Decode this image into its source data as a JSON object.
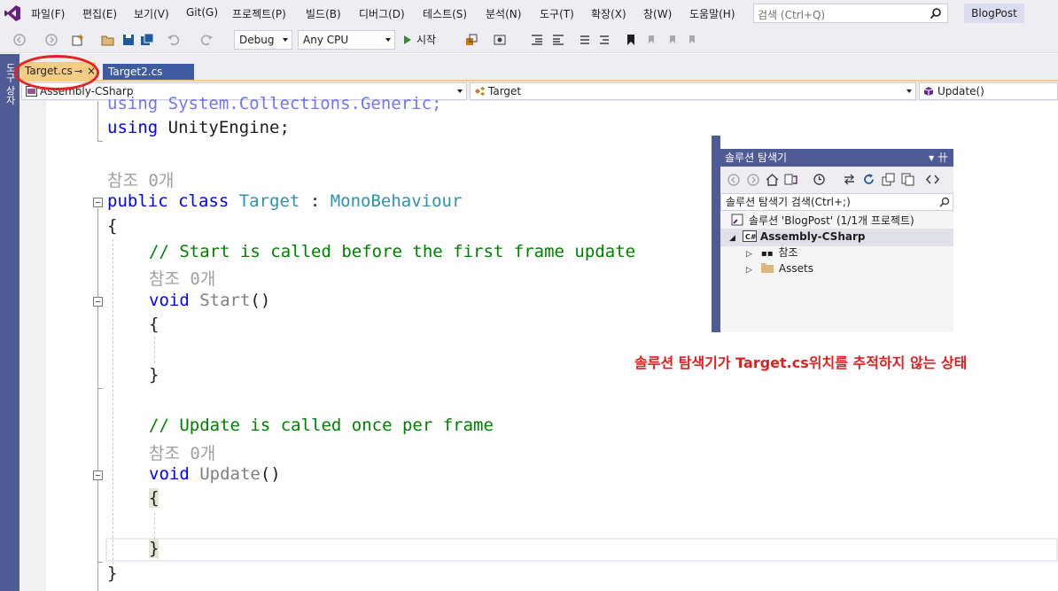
{
  "menu": {
    "items": [
      "파일(F)",
      "편집(E)",
      "보기(V)",
      "Git(G)",
      "프로젝트(P)",
      "빌드(B)",
      "디버그(D)",
      "테스트(S)",
      "분석(N)",
      "도구(T)",
      "확장(X)",
      "창(W)",
      "도움말(H)"
    ],
    "search_placeholder": "검색 (Ctrl+Q)",
    "project_name": "BlogPost"
  },
  "toolbar": {
    "config": "Debug",
    "platform": "Any CPU",
    "start_label": "시작"
  },
  "left_strip_label": "도구 상자",
  "tabs": {
    "active": "Target.cs",
    "active_pin": "⊸",
    "active_close": "×",
    "inactive": "Target2.cs"
  },
  "navbar": {
    "project": "Assembly-CSharp",
    "type": "Target",
    "member": "Update()"
  },
  "code": {
    "l1": "using System.Collections.Generic;",
    "l2_kw": "using",
    "l2_rest": " UnityEngine;",
    "ref_class": "참조 0개",
    "l4_kw": "public class",
    "l4_type": "Target",
    "l4_colon": " : ",
    "l4_base": "MonoBehaviour",
    "brace_open": "{",
    "brace_close": "}",
    "c_start": "// Start is called before the first frame update",
    "ref_start": "참조 0개",
    "void": "void",
    "start_name": "Start",
    "parens": "()",
    "c_update": "// Update is called once per frame",
    "ref_update": "참조 0개",
    "update_name": "Update"
  },
  "solution_explorer": {
    "title": "솔루션 탐색기",
    "header_pin": "▾ 卄",
    "search_placeholder": "솔루션 탐색기 검색(Ctrl+;)",
    "solution_label": "솔루션 'BlogPost' (1/1개 프로젝트)",
    "project_label": "Assembly-CSharp",
    "references_label": "참조",
    "assets_label": "Assets"
  },
  "annotation": "솔루션 탐색기가 Target.cs위치를 추적하지 않는 상태",
  "colors": {
    "accent": "#4f5b95",
    "active_tab": "#f5cc84",
    "annotation": "#e02020"
  }
}
